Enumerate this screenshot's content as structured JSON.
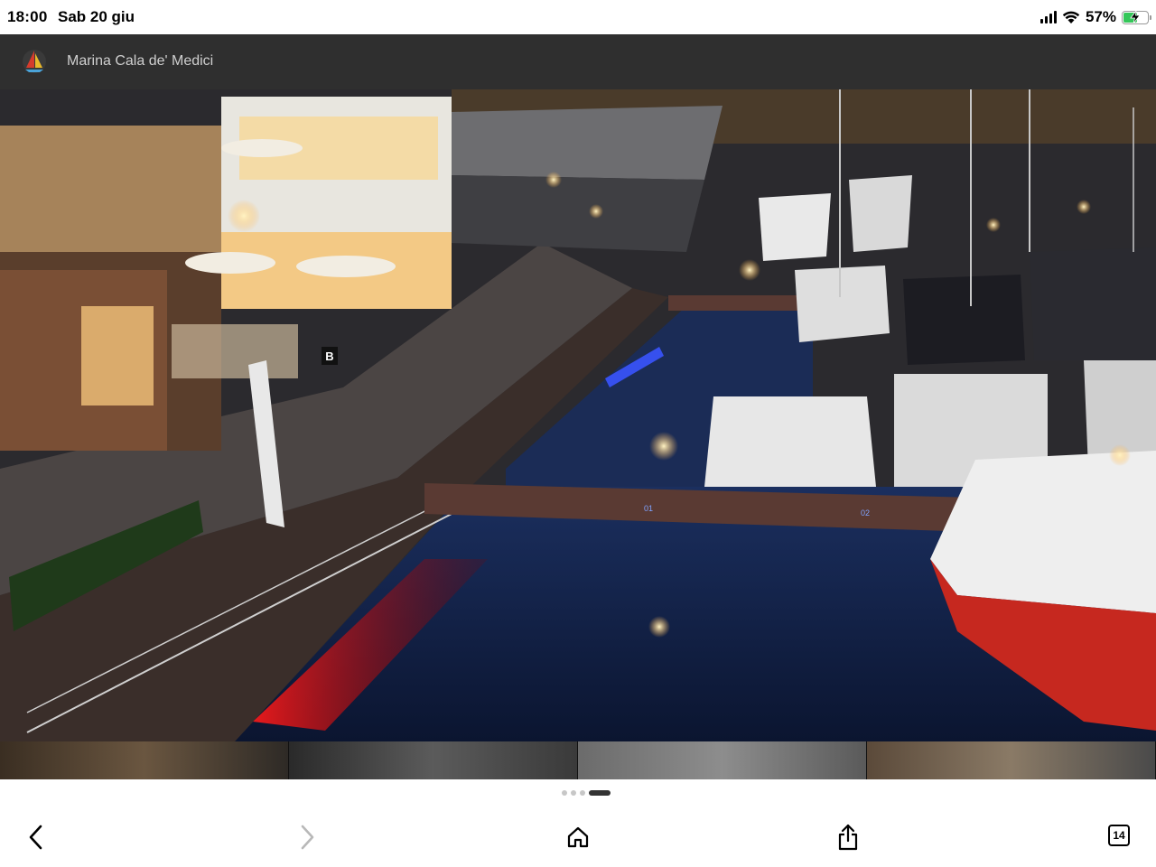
{
  "status_bar": {
    "time": "18:00",
    "date": "Sab 20 giu",
    "battery_percent": "57%",
    "battery_level": 0.57,
    "charging": true,
    "icons": [
      "cellular-signal-icon",
      "wifi-icon",
      "battery-charging-icon"
    ]
  },
  "header": {
    "title": "Marina Cala de' Medici",
    "logo_icon": "sailboat-logo-icon"
  },
  "gallery": {
    "pager": {
      "count": 4,
      "active_index": 3
    },
    "photo_labels": [
      "B",
      "01",
      "02"
    ]
  },
  "toolbar": {
    "back_icon": "chevron-left-icon",
    "forward_icon": "chevron-right-icon",
    "home_icon": "home-icon",
    "share_icon": "share-icon",
    "tabs_count": "14"
  },
  "colors": {
    "header_bg": "#2f2f2f",
    "header_text": "#cfcfcf",
    "battery_green": "#34c759",
    "pager_active": "#333333",
    "pager_inactive": "#c7c7c7"
  }
}
